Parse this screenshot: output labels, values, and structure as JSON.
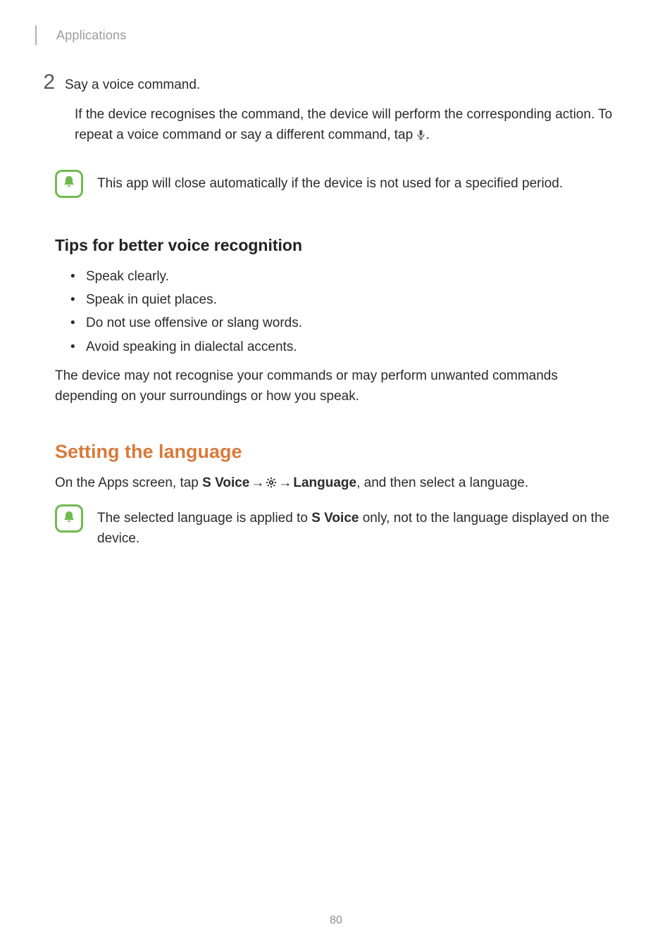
{
  "header": {
    "section": "Applications"
  },
  "step": {
    "number": "2",
    "title": "Say a voice command.",
    "body_line1": "If the device recognises the command, the device will perform the corresponding action. ",
    "body_line2_pre": "To repeat a voice command or say a different command, tap ",
    "body_line2_post": "."
  },
  "note1": "This app will close automatically if the device is not used for a specified period.",
  "tips": {
    "heading": "Tips for better voice recognition",
    "items": [
      "Speak clearly.",
      "Speak in quiet places.",
      "Do not use offensive or slang words.",
      "Avoid speaking in dialectal accents."
    ],
    "footer": "The device may not recognise your commands or may perform unwanted commands depending on your surroundings or how you speak."
  },
  "lang": {
    "heading": "Setting the language",
    "instr_pre": "On the Apps screen, tap ",
    "svoice": "S Voice",
    "arrow": " → ",
    "language": "Language",
    "instr_post": ", and then select a language."
  },
  "note2_pre": "The selected language is applied to ",
  "note2_bold": "S Voice",
  "note2_post": " only, not to the language displayed on the device.",
  "page_number": "80"
}
